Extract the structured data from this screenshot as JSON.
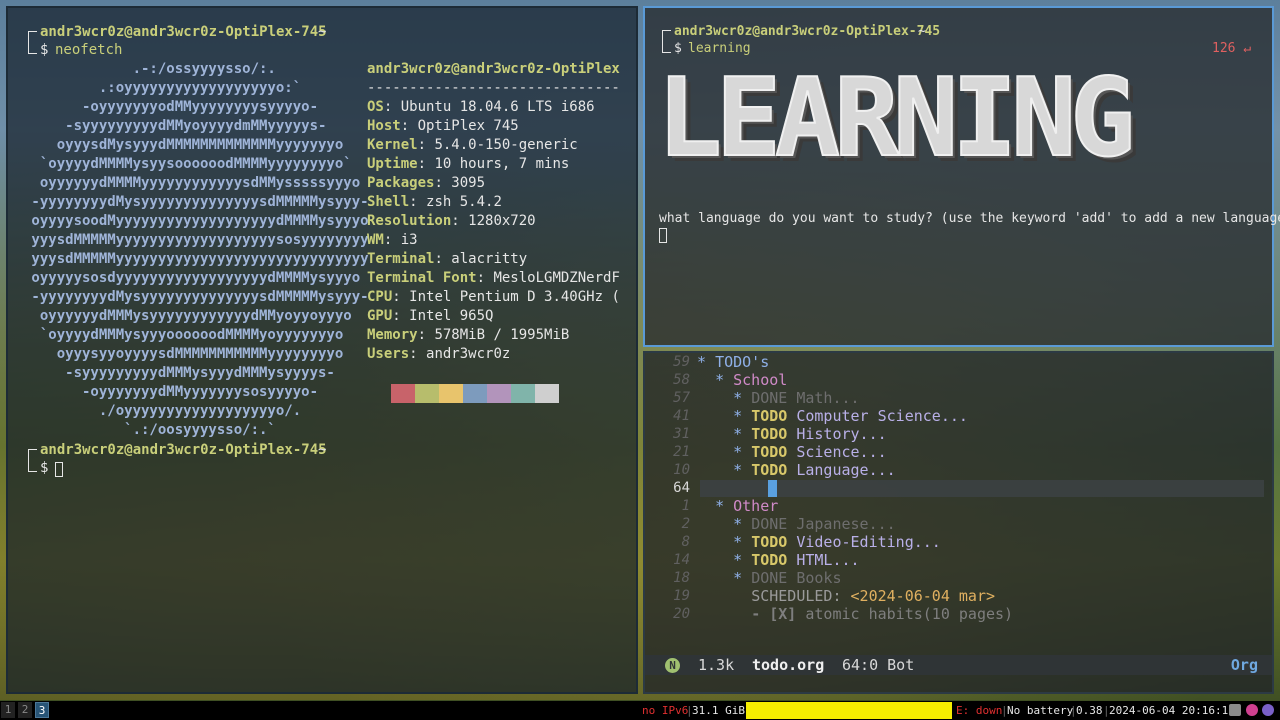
{
  "left_terminal": {
    "prompt_user": "andr3wcr0z@andr3wcr0z-OptiPlex-745",
    "prompt_path": "~",
    "prompt_symbol": "$",
    "command": "neofetch",
    "logo": [
      "             .-:/ossyyyysso/:.",
      "         .:oyyyyyyyyyyyyyyyyyyo:`",
      "       -oyyyyyyyodMMyyyyyyyysyyyyo-",
      "     -syyyyyyyyydMMyoyyyydmMMyyyyys-",
      "    oyyysdMysyyydMMMMMMMMMMMMMyyyyyyyo",
      "  `oyyyydMMMMysyysoooooodMMMMyyyyyyyyo`",
      "  oyyyyyydMMMMyyyyyyyyyyyysdMMysssssyyyo",
      " -yyyyyyyydMysyyyyyyyyyyyyyysdMMMMMysyyy-",
      " oyyyysoodMyyyyyyyyyyyyyyyyyyydMMMMysyyyo",
      " yyysdMMMMMyyyyyyyyyyyyyyyyyyysosyyyyyyyy",
      " yyysdMMMMMyyyyyyyyyyyyyyyyyyyyyyyyyyyyyy",
      " oyyyyysosdyyyyyyyyyyyyyyyyyydMMMMysyyyo",
      " -yyyyyyyydMysyyyyyyyyyyyyyysdMMMMMysyyy-",
      "  oyyyyyydMMMysyyyyyyyyyyyydMMyoyyoyyyo",
      "  `oyyyydMMMysyyyoooooodMMMMyoyyyyyyyo",
      "    oyyysyyoyyyysdMMMMMMMMMMMyyyyyyyyo",
      "     -syyyyyyyyydMMMysyyydMMMysyyyys-",
      "       -oyyyyyyydMMyyyyyyysosyyyyo-",
      "         ./oyyyyyyyyyyyyyyyyyyo/.",
      "            `.:/oosyyyysso/:.`"
    ],
    "info_title": "andr3wcr0z@andr3wcr0z-OptiPlex",
    "info_sep": "------------------------------",
    "info": [
      {
        "k": "OS",
        "v": "Ubuntu 18.04.6 LTS i686"
      },
      {
        "k": "Host",
        "v": "OptiPlex 745"
      },
      {
        "k": "Kernel",
        "v": "5.4.0-150-generic"
      },
      {
        "k": "Uptime",
        "v": "10 hours, 7 mins"
      },
      {
        "k": "Packages",
        "v": "3095"
      },
      {
        "k": "Shell",
        "v": "zsh 5.4.2"
      },
      {
        "k": "Resolution",
        "v": "1280x720"
      },
      {
        "k": "WM",
        "v": "i3"
      },
      {
        "k": "Terminal",
        "v": "alacritty"
      },
      {
        "k": "Terminal Font",
        "v": "MesloLGMDZNerdF"
      },
      {
        "k": "CPU",
        "v": "Intel Pentium D 3.40GHz ("
      },
      {
        "k": "GPU",
        "v": "Intel 965Q"
      },
      {
        "k": "Memory",
        "v": "578MiB / 1995MiB"
      },
      {
        "k": "Users",
        "v": "andr3wcr0z"
      }
    ],
    "palette": [
      "#c8636a",
      "#b7bd6c",
      "#e8c46c",
      "#7d9bbd",
      "#b294bb",
      "#80b4aa",
      "#cfcfcf"
    ]
  },
  "top_right_terminal": {
    "prompt_user": "andr3wcr0z@andr3wcr0z-OptiPlex-745",
    "prompt_path": "~",
    "prompt_symbol": "$",
    "command": "learning",
    "exit_code": "126 ↵",
    "banner": "LEARNING",
    "question": "what language do you want to study? (use the keyword 'add' to add a new language)"
  },
  "editor": {
    "lines": [
      {
        "num": "59",
        "indent": "",
        "star": "*",
        "kw": "",
        "text": "TODO's",
        "cls": "h1"
      },
      {
        "num": "58",
        "indent": "  ",
        "star": "*",
        "kw": "",
        "text": "School",
        "cls": "h2"
      },
      {
        "num": "57",
        "indent": "    ",
        "star": "*",
        "kw": "DONE",
        "text": "Math...",
        "cls": "done"
      },
      {
        "num": "41",
        "indent": "    ",
        "star": "*",
        "kw": "TODO",
        "text": "Computer Science...",
        "cls": "item"
      },
      {
        "num": "31",
        "indent": "    ",
        "star": "*",
        "kw": "TODO",
        "text": "History...",
        "cls": "item"
      },
      {
        "num": "21",
        "indent": "    ",
        "star": "*",
        "kw": "TODO",
        "text": "Science...",
        "cls": "item"
      },
      {
        "num": "10",
        "indent": "    ",
        "star": "*",
        "kw": "TODO",
        "text": "Language...",
        "cls": "item"
      },
      {
        "num": "64",
        "indent": "",
        "star": "",
        "kw": "",
        "text": "",
        "cls": "cur"
      },
      {
        "num": "1",
        "indent": "  ",
        "star": "*",
        "kw": "",
        "text": "Other",
        "cls": "h2"
      },
      {
        "num": "2",
        "indent": "    ",
        "star": "*",
        "kw": "DONE",
        "text": "Japanese...",
        "cls": "done"
      },
      {
        "num": "8",
        "indent": "    ",
        "star": "*",
        "kw": "TODO",
        "text": "Video-Editing...",
        "cls": "item"
      },
      {
        "num": "14",
        "indent": "    ",
        "star": "*",
        "kw": "TODO",
        "text": "HTML...",
        "cls": "item"
      },
      {
        "num": "18",
        "indent": "    ",
        "star": "*",
        "kw": "DONE",
        "text": "Books",
        "cls": "done"
      },
      {
        "num": "19",
        "indent": "      ",
        "star": "",
        "kw": "SCHEDULED:",
        "text": "<2024-06-04 mar>",
        "cls": "sched"
      },
      {
        "num": "20",
        "indent": "      ",
        "star": "",
        "kw": "- [X]",
        "text": "atomic habits(10 pages)",
        "cls": "check"
      }
    ],
    "modeline": {
      "mode_badge": "N",
      "size": "1.3k",
      "filename": "todo.org",
      "position": "64:0 Bot",
      "major_mode": "Org"
    }
  },
  "bar": {
    "workspaces": [
      "1",
      "2",
      "3"
    ],
    "active_workspace": "3",
    "ipv6": "no IPv6",
    "disk": "31.1 GiB",
    "eth": "E: down",
    "battery": "No battery",
    "load": "0.38",
    "datetime": "2024-06-04 20:16:15"
  }
}
